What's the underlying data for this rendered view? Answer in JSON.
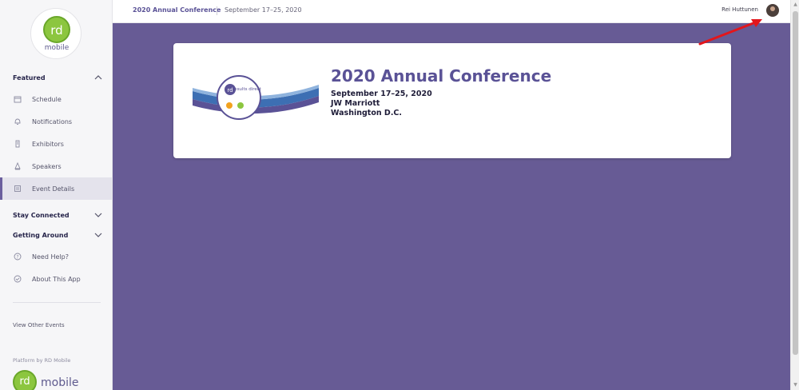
{
  "sidebar": {
    "logo_letters": "rd",
    "logo_word": "mobile",
    "sections": [
      {
        "label": "Featured"
      },
      {
        "label": "Stay Connected"
      },
      {
        "label": "Getting Around"
      }
    ],
    "featured_items": [
      {
        "label": "Schedule",
        "icon": "calendar-icon"
      },
      {
        "label": "Notifications",
        "icon": "bell-icon"
      },
      {
        "label": "Exhibitors",
        "icon": "booth-icon"
      },
      {
        "label": "Speakers",
        "icon": "speaker-icon"
      },
      {
        "label": "Event Details",
        "icon": "details-icon"
      }
    ],
    "getting_around_items": [
      {
        "label": "Need Help?",
        "icon": "help-icon"
      },
      {
        "label": "About This App",
        "icon": "check-circle-icon"
      }
    ],
    "view_other_events": "View Other Events",
    "platform_text": "Platform by RD Mobile",
    "bottom_logo_letters": "rd",
    "bottom_logo_word": "mobile"
  },
  "header": {
    "event_title": "2020 Annual Conference",
    "event_dates": "September 17–25, 2020",
    "user_name": "Rei Huttunen"
  },
  "event_card": {
    "title": "2020 Annual Conference",
    "dates": "September 17–25, 2020",
    "venue": "JW Marriott",
    "city": "Washington D.C.",
    "banner_logo_letters": "rd",
    "banner_logo_text": "results direct"
  },
  "colors": {
    "accent": "#5a5296",
    "main_background": "#675b95",
    "annotation_arrow": "#e3161b"
  }
}
